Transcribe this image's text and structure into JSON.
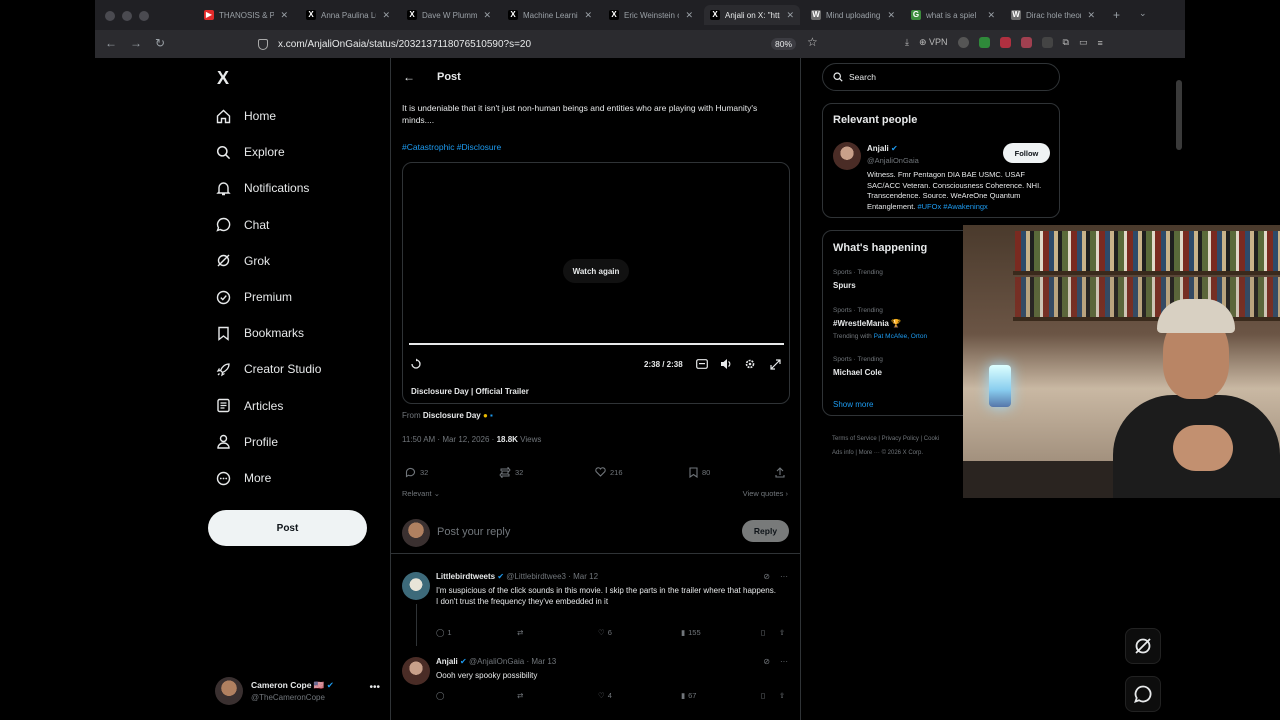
{
  "browser": {
    "tabs": [
      {
        "title": "THANOSIS & PR",
        "color": "#e02a2a",
        "glyph": "▶"
      },
      {
        "title": "Anna Paulina Lu",
        "color": "#000000",
        "glyph": "X"
      },
      {
        "title": "Dave W Plummer",
        "color": "#000000",
        "glyph": "X"
      },
      {
        "title": "Machine Learnin",
        "color": "#000000",
        "glyph": "X"
      },
      {
        "title": "Eric Weinstein o",
        "color": "#000000",
        "glyph": "X"
      },
      {
        "title": "Anjali on X: \"http",
        "color": "#000000",
        "glyph": "X"
      },
      {
        "title": "Mind uploading",
        "color": "#6c6c6c",
        "glyph": "W"
      },
      {
        "title": "what is a spiel",
        "color": "#3c8c3c",
        "glyph": "G"
      },
      {
        "title": "Dirac hole theor",
        "color": "#6c6c6c",
        "glyph": "W"
      }
    ],
    "url": "x.com/AnjaliOnGaia/status/2032137118076510590?s=20",
    "zoom": "80%",
    "vpn": "VPN"
  },
  "nav": {
    "logo": "X",
    "items": [
      {
        "label": "Home",
        "icon": "home-icon"
      },
      {
        "label": "Explore",
        "icon": "search-icon"
      },
      {
        "label": "Notifications",
        "icon": "bell-icon"
      },
      {
        "label": "Chat",
        "icon": "chat-icon"
      },
      {
        "label": "Grok",
        "icon": "grok-icon"
      },
      {
        "label": "Premium",
        "icon": "premium-icon"
      },
      {
        "label": "Bookmarks",
        "icon": "bookmark-icon"
      },
      {
        "label": "Creator Studio",
        "icon": "rocket-icon"
      },
      {
        "label": "Articles",
        "icon": "article-icon"
      },
      {
        "label": "Profile",
        "icon": "person-icon"
      },
      {
        "label": "More",
        "icon": "more-icon"
      }
    ],
    "post_button": "Post",
    "account": {
      "name": "Cameron Cope 🇺🇸",
      "handle": "@TheCameronCope"
    }
  },
  "post": {
    "header": "Post",
    "text": "It is undeniable that it isn't just non-human beings and entities who are playing with Humanity's minds....",
    "hashtags": "#Catastrophic #Disclosure",
    "video": {
      "watch_again": "Watch again",
      "time": "2:38 / 2:38",
      "title": "Disclosure Day | Official Trailer",
      "progress": 1.0
    },
    "from_prefix": "From",
    "from_source": "Disclosure Day",
    "timestamp": "11:50 AM · Mar 12, 2026 ·",
    "views_count": "18.8K",
    "views_label": "Views",
    "stats": {
      "replies": "32",
      "reposts": "32",
      "likes": "216",
      "bookmarks": "80"
    },
    "sort": "Relevant",
    "view_quotes": "View quotes",
    "reply_placeholder": "Post your reply",
    "reply_button": "Reply"
  },
  "replies": [
    {
      "name": "Littlebirdtweets",
      "handle": "@Littlebirdtwee3",
      "date": "· Mar 12",
      "text_lines": [
        "I'm suspicious of the click sounds in this movie.  I skip the parts in the trailer where that happens.",
        "I don't trust the frequency they've embedded in it"
      ],
      "stats": {
        "replies": "1",
        "likes": "6",
        "views": "155"
      }
    },
    {
      "name": "Anjali",
      "handle": "@AnjaliOnGaia",
      "date": "· Mar 13",
      "text_lines": [
        "Oooh very spooky possibility"
      ],
      "stats": {
        "replies": "",
        "likes": "4",
        "views": "67"
      }
    }
  ],
  "sidebar": {
    "search_placeholder": "Search",
    "relevant": {
      "title": "Relevant people",
      "name": "Anjali",
      "handle": "@AnjaliOnGaia",
      "follow": "Follow",
      "bio": "Witness. Fmr Pentagon DIA BAE USMC. USAF SAC/ACC Veteran. Consciousness Coherence. NHI. Transcendence. Source. WeAreOne Quantum Entanglement.",
      "bio_tags": "#UFOx #Awakeningx"
    },
    "happening": {
      "title": "What's happening",
      "trends": [
        {
          "context": "Sports · Trending",
          "name": "Spurs",
          "with_prefix": "",
          "with": ""
        },
        {
          "context": "Sports · Trending",
          "name": "#WrestleMania 🏆",
          "with_prefix": "Trending with",
          "with": "Pat McAfee, Orton"
        },
        {
          "context": "Sports · Trending",
          "name": "Michael Cole",
          "with_prefix": "",
          "with": ""
        }
      ],
      "show_more": "Show more"
    },
    "footer": {
      "line1": "Terms of Service  |  Privacy Policy  |  Cooki",
      "line2": "Ads info  |  More ···  © 2026 X Corp."
    }
  },
  "colors": {
    "accent": "#1d9bf0",
    "background": "#000000",
    "border": "#2f3336",
    "muted": "#71767b"
  }
}
